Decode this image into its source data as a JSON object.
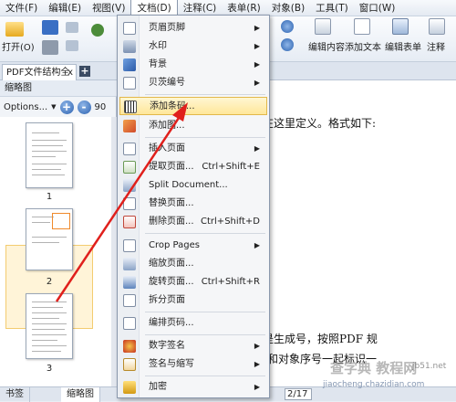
{
  "menubar": {
    "items": [
      "文件(F)",
      "编辑(E)",
      "视图(V)",
      "文档(D)",
      "注释(C)",
      "表单(R)",
      "对象(B)",
      "工具(T)",
      "窗口(W)"
    ]
  },
  "toolbar": {
    "open_label": "打开(O)",
    "edit_content_label": "编辑内容",
    "add_text_label": "添加文本",
    "edit_form_label": "编辑表单",
    "annotate_label": "注释"
  },
  "tabs": {
    "doc_tab_label": "PDF文件结构全",
    "close_glyph": "x",
    "add_glyph": "+"
  },
  "panel": {
    "title": "缩略图",
    "options_label": "Options...",
    "zoom_in": "+",
    "zoom_out": "-",
    "zoom_value": "90",
    "thumb_numbers": [
      "1",
      "2",
      "3"
    ]
  },
  "document": {
    "line1": "在这里定义。格式如下:",
    "line2": "是生成号，按照PDF 规",
    "line3": "和对象序号一起标识一"
  },
  "bottombar": {
    "tab_bookmarks": "书签",
    "tab_thumbnails": "缩略图",
    "page_current": "2",
    "page_total": "/17"
  },
  "watermark": {
    "text": "查字典 教程网",
    "site": "jiaocheng.chazidian.com",
    "site2": "jb51.net"
  },
  "menu": {
    "items": [
      {
        "label": "页眉页脚",
        "shortcut": "",
        "submenu": true
      },
      {
        "label": "水印",
        "shortcut": "",
        "submenu": true
      },
      {
        "label": "背景",
        "shortcut": "",
        "submenu": true
      },
      {
        "label": "贝茨编号",
        "shortcut": "",
        "submenu": true
      },
      {
        "label": "添加条码...",
        "shortcut": "",
        "submenu": false
      },
      {
        "label": "添加图...",
        "shortcut": "",
        "submenu": false
      },
      {
        "label": "插入页面",
        "shortcut": "",
        "submenu": true
      },
      {
        "label": "提取页面...",
        "shortcut": "Ctrl+Shift+E",
        "submenu": false
      },
      {
        "label": "Split Document...",
        "shortcut": "",
        "submenu": false
      },
      {
        "label": "替换页面...",
        "shortcut": "",
        "submenu": false
      },
      {
        "label": "删除页面...",
        "shortcut": "Ctrl+Shift+D",
        "submenu": false
      },
      {
        "label": "Crop Pages",
        "shortcut": "",
        "submenu": true
      },
      {
        "label": "缩放页面...",
        "shortcut": "",
        "submenu": false
      },
      {
        "label": "旋转页面...",
        "shortcut": "Ctrl+Shift+R",
        "submenu": false
      },
      {
        "label": "拆分页面",
        "shortcut": "",
        "submenu": false
      },
      {
        "label": "编排页码...",
        "shortcut": "",
        "submenu": false
      },
      {
        "label": "数字签名",
        "shortcut": "",
        "submenu": true
      },
      {
        "label": "签名与缩写",
        "shortcut": "",
        "submenu": true
      },
      {
        "label": "加密",
        "shortcut": "",
        "submenu": true
      }
    ],
    "arrow_glyph": "▶"
  }
}
